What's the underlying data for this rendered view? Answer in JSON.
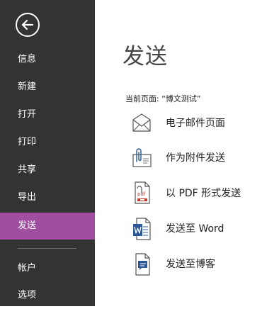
{
  "sidebar": {
    "items": [
      {
        "label": "信息"
      },
      {
        "label": "新建"
      },
      {
        "label": "打开"
      },
      {
        "label": "打印"
      },
      {
        "label": "共享"
      },
      {
        "label": "导出"
      },
      {
        "label": "发送"
      },
      {
        "label": "帐户"
      },
      {
        "label": "选项"
      }
    ],
    "active_index": 6
  },
  "main": {
    "title": "发送",
    "current_page": "当前页面: “博文测试”",
    "actions": [
      {
        "label": "电子邮件页面",
        "icon": "envelope-icon"
      },
      {
        "label": "作为附件发送",
        "icon": "attachment-icon"
      },
      {
        "label": "以 PDF 形式发送",
        "icon": "pdf-icon"
      },
      {
        "label": "发送至 Word",
        "icon": "word-icon"
      },
      {
        "label": "发送至博客",
        "icon": "blog-icon"
      }
    ]
  },
  "colors": {
    "sidebar_bg": "#333333",
    "accent": "#a04fa0",
    "word_blue": "#2b5797",
    "pdf_red": "#c0392b"
  }
}
